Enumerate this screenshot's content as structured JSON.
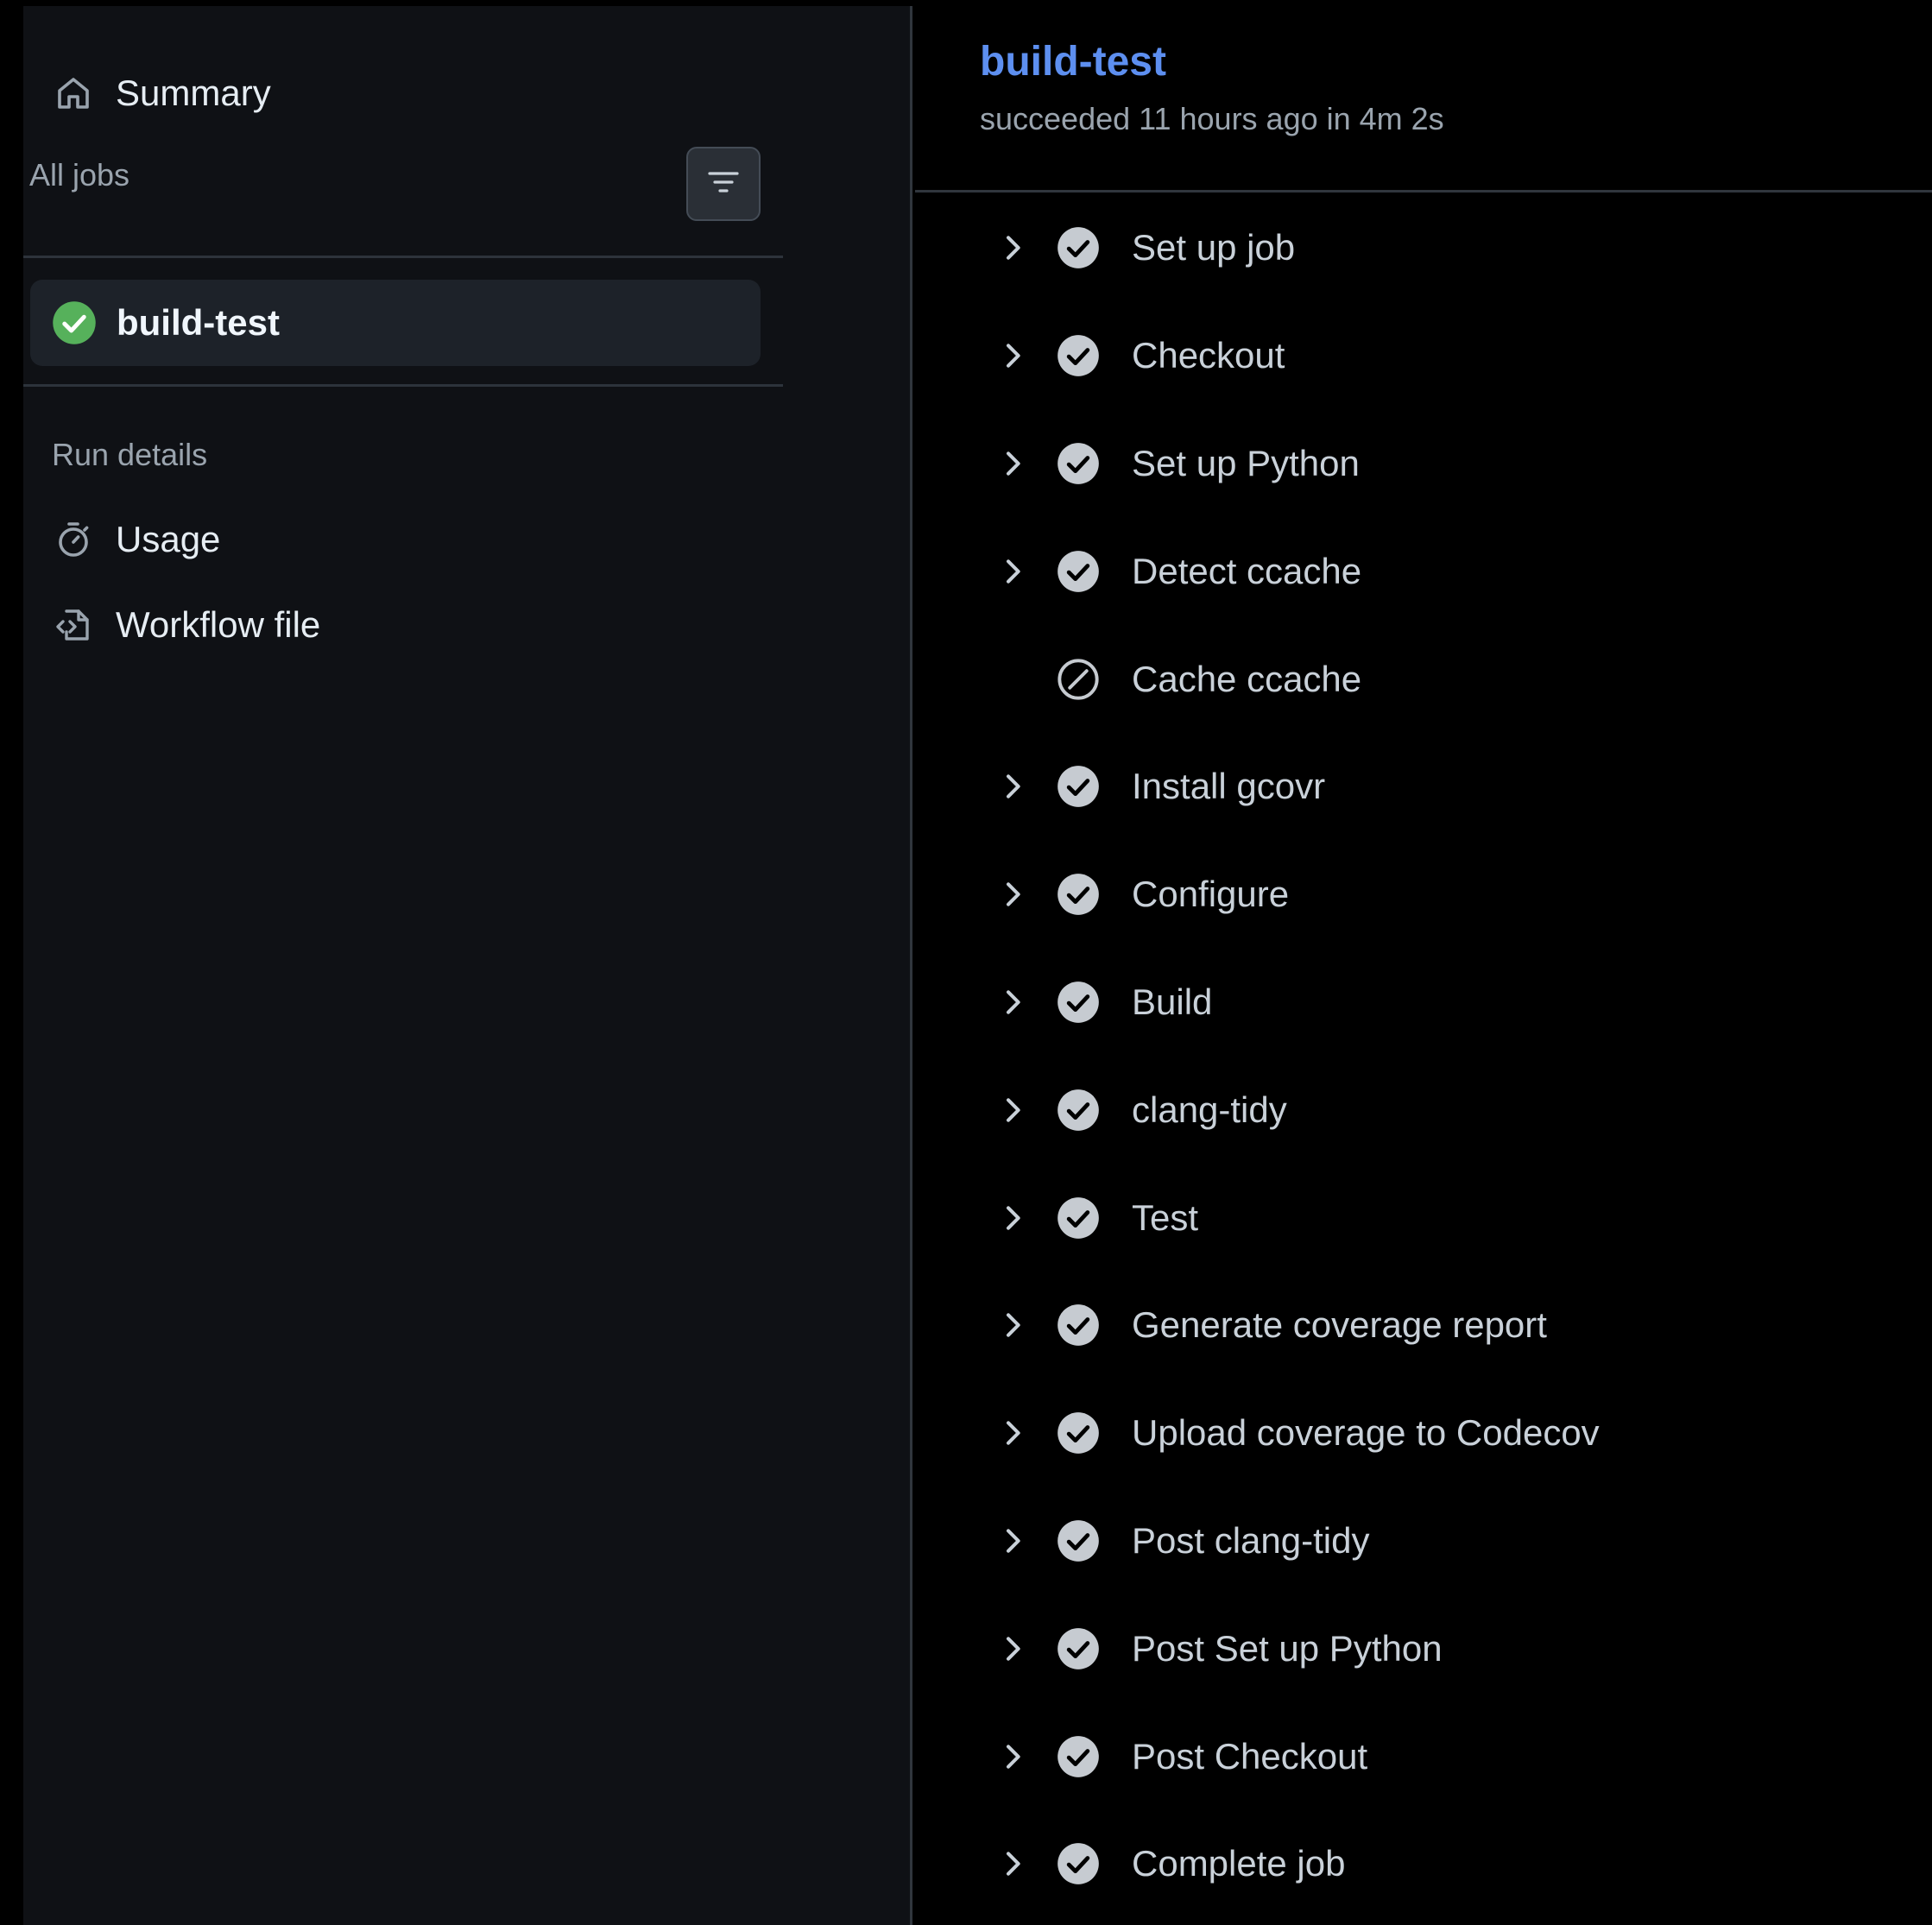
{
  "sidebar": {
    "summary_label": "Summary",
    "all_jobs_label": "All jobs",
    "jobs": [
      {
        "name": "build-test",
        "status": "success"
      }
    ],
    "run_details_label": "Run details",
    "run_details_items": [
      {
        "label": "Usage",
        "icon": "stopwatch-icon"
      },
      {
        "label": "Workflow file",
        "icon": "file-code-icon"
      }
    ]
  },
  "main": {
    "job_title": "build-test",
    "job_meta": "succeeded 11 hours ago in 4m 2s",
    "steps": [
      {
        "label": "Set up job",
        "status": "success",
        "expandable": true
      },
      {
        "label": "Checkout",
        "status": "success",
        "expandable": true
      },
      {
        "label": "Set up Python",
        "status": "success",
        "expandable": true
      },
      {
        "label": "Detect ccache",
        "status": "success",
        "expandable": true
      },
      {
        "label": "Cache ccache",
        "status": "skipped",
        "expandable": false
      },
      {
        "label": "Install gcovr",
        "status": "success",
        "expandable": true
      },
      {
        "label": "Configure",
        "status": "success",
        "expandable": true
      },
      {
        "label": "Build",
        "status": "success",
        "expandable": true
      },
      {
        "label": "clang-tidy",
        "status": "success",
        "expandable": true
      },
      {
        "label": "Test",
        "status": "success",
        "expandable": true
      },
      {
        "label": "Generate coverage report",
        "status": "success",
        "expandable": true
      },
      {
        "label": "Upload coverage to Codecov",
        "status": "success",
        "expandable": true
      },
      {
        "label": "Post clang-tidy",
        "status": "success",
        "expandable": true
      },
      {
        "label": "Post Set up Python",
        "status": "success",
        "expandable": true
      },
      {
        "label": "Post Checkout",
        "status": "success",
        "expandable": true
      },
      {
        "label": "Complete job",
        "status": "success",
        "expandable": true
      }
    ]
  },
  "colors": {
    "success_green": "#56b15b",
    "step_check_grey": "#c6cbd1",
    "link_blue": "#5d8ff0"
  }
}
